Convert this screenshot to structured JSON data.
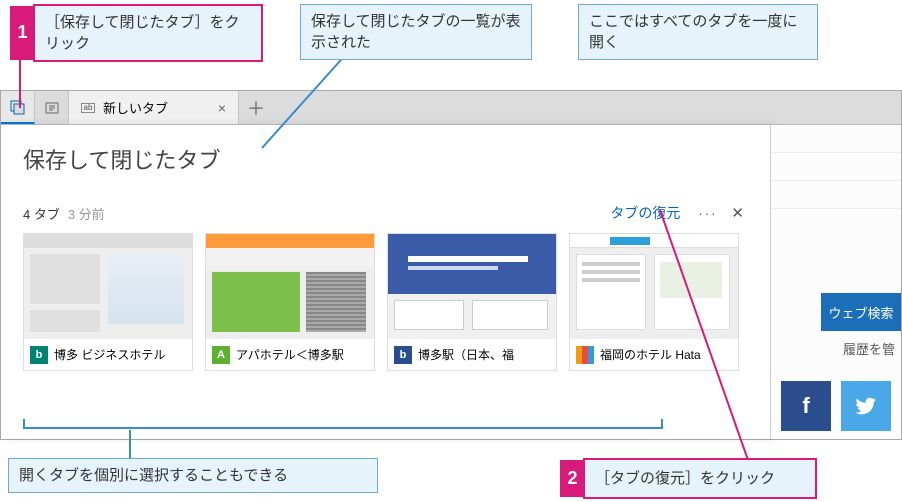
{
  "callouts": {
    "c1": {
      "num": "1",
      "text": "［保存して閉じたタブ］をクリック"
    },
    "c2": {
      "text": "保存して閉じたタブの一覧が表示された"
    },
    "c3": {
      "text": "ここではすべてのタブを一度に開く"
    },
    "c4": {
      "text": "開くタブを個別に選択することもできる"
    },
    "c5": {
      "num": "2",
      "text": "［タブの復元］をクリック"
    }
  },
  "tabstrip": {
    "newtab_label": "新しいタブ"
  },
  "panel": {
    "title": "保存して閉じたタブ",
    "count": "4 タブ",
    "time": "3 分前",
    "restore": "タブの復元"
  },
  "thumbs": [
    {
      "label": "博多 ビジネスホテル"
    },
    {
      "label": "アパホテル＜博多駅"
    },
    {
      "label": "博多駅（日本、福"
    },
    {
      "label": "福岡のホテル Hata"
    }
  ],
  "right": {
    "websearch": "ウェブ検索",
    "history": "履歴を管"
  }
}
